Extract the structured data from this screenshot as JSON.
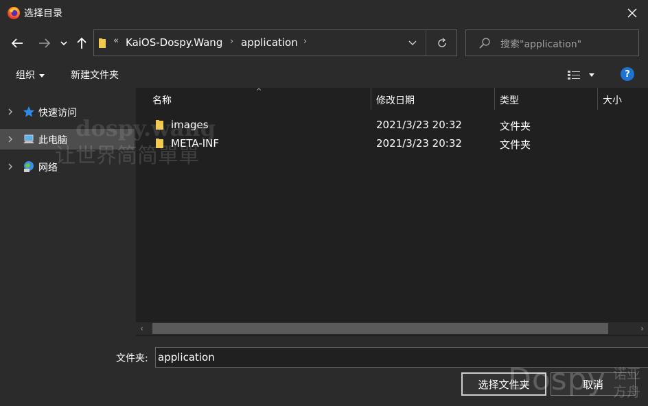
{
  "window": {
    "title": "选择目录",
    "icon": "firefox-icon"
  },
  "nav": {
    "back": "arrow-left-icon",
    "forward": "arrow-right-icon",
    "recent": "chevron-down-icon",
    "up": "arrow-up-icon",
    "breadcrumb": [
      "KaiOS-Dospy.Wang",
      "application"
    ],
    "refresh": "refresh-icon"
  },
  "search": {
    "placeholder": "搜索\"application\""
  },
  "toolbar": {
    "organize": "组织",
    "new_folder": "新建文件夹"
  },
  "sidebar": {
    "items": [
      {
        "label": "快速访问",
        "icon": "star-icon",
        "selected": false
      },
      {
        "label": "此电脑",
        "icon": "computer-icon",
        "selected": true
      },
      {
        "label": "网络",
        "icon": "network-icon",
        "selected": false
      }
    ]
  },
  "columns": {
    "name": "名称",
    "modified": "修改日期",
    "type": "类型",
    "size": "大小"
  },
  "files": [
    {
      "name": "images",
      "modified": "2021/3/23 20:32",
      "type": "文件夹"
    },
    {
      "name": "META-INF",
      "modified": "2021/3/23 20:32",
      "type": "文件夹"
    }
  ],
  "footer": {
    "folder_label": "文件夹:",
    "folder_value": "application",
    "select_button": "选择文件夹",
    "cancel_button": "取消"
  },
  "watermarks": {
    "left_line1": "dospy.wang",
    "left_line2": "让世界简简單單",
    "right_brand": "Dospy",
    "right_cn": "诺亚方舟"
  },
  "colors": {
    "background": "#2b2b2b",
    "content_background": "#202020",
    "selected": "#4d4d4d",
    "accent": "#1e73d0",
    "folder": "#f2c94c"
  }
}
